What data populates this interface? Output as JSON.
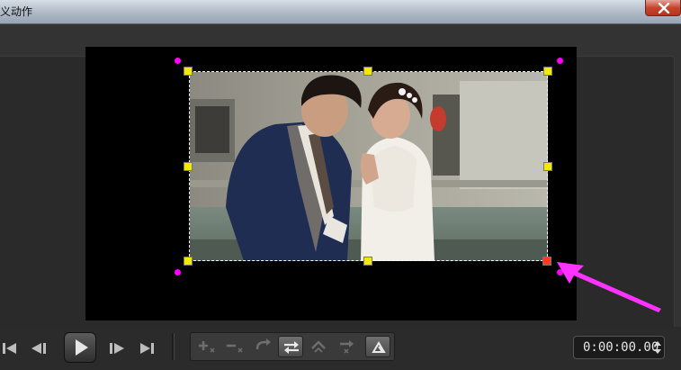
{
  "window": {
    "title": "义动作",
    "title_bar_color": "#aeb9c6",
    "close_icon": "close-icon"
  },
  "preview": {
    "background": "#000000",
    "image_description_icon": "photo-couple",
    "selection_handle_color": "#f6e900",
    "active_handle_color": "#ff3b1a",
    "rotation_dot_color": "#ff00ff",
    "pointer_arrow_color": "#ff33ff"
  },
  "playback": {
    "buttons": [
      {
        "name": "go-to-start",
        "icon": "skip-start-icon"
      },
      {
        "name": "previous-frame",
        "icon": "step-back-icon"
      },
      {
        "name": "play",
        "icon": "play-icon"
      },
      {
        "name": "next-frame",
        "icon": "step-forward-icon"
      },
      {
        "name": "go-to-end",
        "icon": "skip-end-icon"
      }
    ]
  },
  "motion_tools": {
    "buttons": [
      {
        "name": "add-keyframe",
        "icon": "add-keyframe-icon",
        "enabled": false
      },
      {
        "name": "remove-keyframe",
        "icon": "remove-keyframe-icon",
        "enabled": false
      },
      {
        "name": "reverse",
        "icon": "reverse-icon",
        "enabled": false
      },
      {
        "name": "swap-path",
        "icon": "swap-arrows-icon",
        "enabled": true
      },
      {
        "name": "move-left",
        "icon": "move-left-icon",
        "enabled": false
      },
      {
        "name": "move-right",
        "icon": "move-right-icon",
        "enabled": false
      },
      {
        "name": "rotate",
        "icon": "rotate-icon",
        "enabled": true
      }
    ]
  },
  "timecode": {
    "value": "0:00:00.00"
  }
}
